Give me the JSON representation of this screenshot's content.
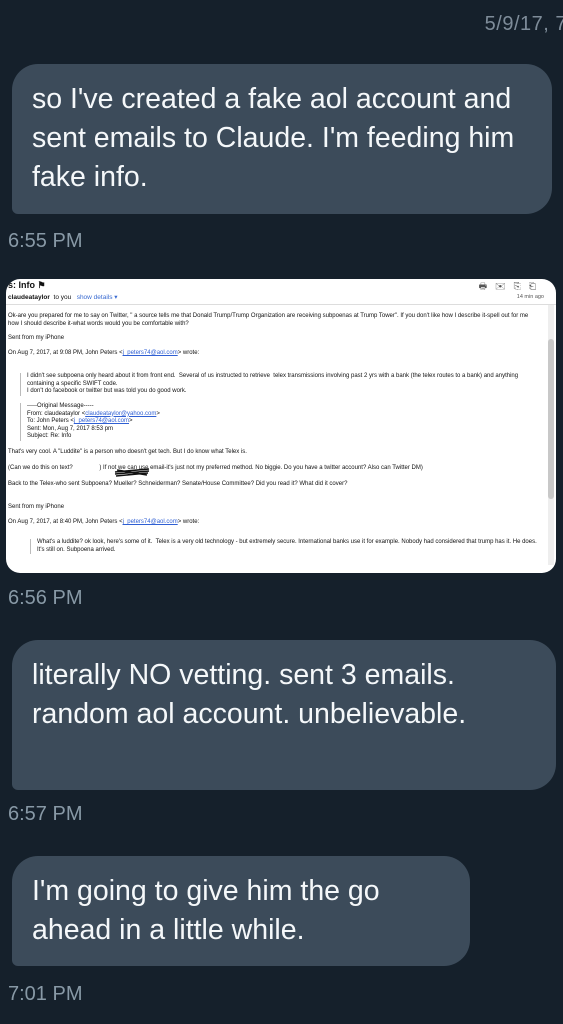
{
  "header": {
    "date": "5/9/17, 7"
  },
  "messages": [
    {
      "text": "so I've created a fake aol account and sent emails to Claude. I'm feeding him fake info.",
      "time": "6:55 PM"
    },
    {
      "time": "6:56 PM"
    },
    {
      "text": "literally NO vetting. sent 3 emails. random aol account. unbelievable.",
      "time": "6:57 PM"
    },
    {
      "text": "I'm going to give him the go ahead in a little while.",
      "time": "7:01 PM"
    }
  ],
  "email": {
    "title": "s: Info",
    "sender": "claudeataylor",
    "to": "to you",
    "details": "show details",
    "age": "14 min ago",
    "p1": "Ok-are you prepared for me to say on Twitter, \" a source tells me that Donald Trump/Trump Organization are receiving subpoenas at Trump Tower\". If you don't like how I describe it-spell out for me how I should describe it-what words would you be comfortable with?",
    "sent1": "Sent from my iPhone",
    "on1": "On Aug 7, 2017, at 9:08 PM, John Peters <",
    "email1": "j_peters74@aol.com",
    "on1b": "> wrote:",
    "q1": "I didn't see subpoena only heard about it from front end.  Several of us instructed to retrieve  telex transmissions involving past 2 yrs with a bank (the telex routes to a bank) and anything containing a specific SWIFT code.\nI don't do facebook or twitter but was told you do good work.",
    "q2a": "-----Original Message-----\nFrom: claudeataylor <",
    "email2": "claudeataylor@yahoo.com",
    "q2b": ">\nTo: John Peters <",
    "email3": "j_peters74@aol.com",
    "q2c": ">\nSent: Mon, Aug 7, 2017 8:53 pm\nSubject: Re: Info",
    "p2": "That's very cool. A \"Luddite\" is a person who doesn't get tech. But I do know what Telex is.",
    "p3": "(Can we do this on text?                ) If not we can use email-it's just not my preferred method. No biggie. Do you have a twitter account? Also can Twitter DM)",
    "p4": "Back to the Telex-who sent Subpoena? Mueller? Schneiderman? Senate/House Committee? Did you read it? What did it cover?",
    "sent2": "Sent from my iPhone",
    "on2": "On Aug 7, 2017, at 8:40 PM, John Peters <",
    "email4": "j_peters74@aol.com",
    "on2b": "> wrote:",
    "q3": "What's a luddite? ok look, here's some of it.  Telex is a very old technology - but extremely secure. International banks use it for example. Nobody had considered that trump has it. He does. It's still on. Subpoena arrived."
  }
}
